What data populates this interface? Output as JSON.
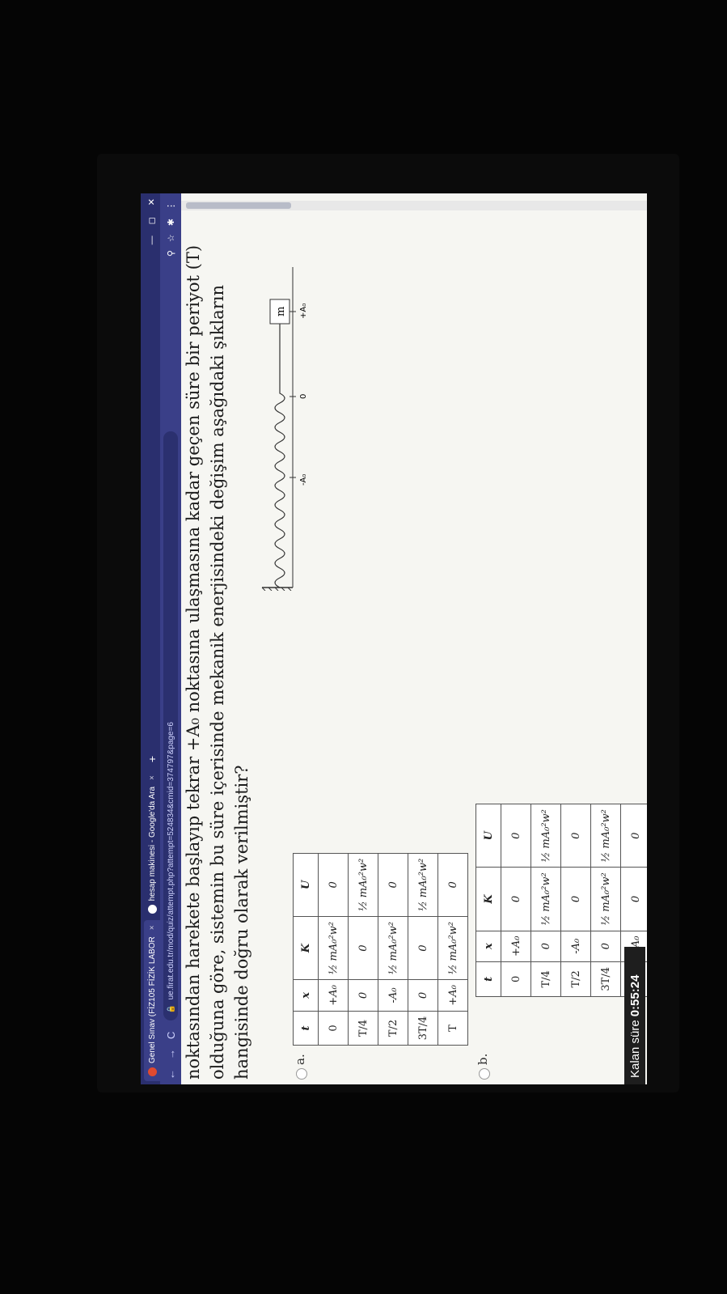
{
  "browser": {
    "tabs": [
      {
        "label": "Genel Sınav (FİZ105 FİZİK LABOR",
        "color": "#e04a2f",
        "active": true
      },
      {
        "label": "hesap makinesi - Google'da Ara",
        "color": "#ffffff",
        "active": false
      }
    ],
    "tab_close": "×",
    "new_tab": "+",
    "window_controls": {
      "minimize": "—",
      "restore": "◻",
      "close": "✕"
    },
    "nav": {
      "back": "←",
      "forward": "→",
      "reload": "C"
    },
    "url": "ue.firat.edu.tr/mod/quiz/attempt.php?attempt=524834&cmid=374797&page=6",
    "addr_icons": {
      "zoom": "⚲",
      "star": "☆",
      "ext1": "✱",
      "menu": "⋮"
    }
  },
  "question": {
    "lines": [
      "noktasından harekete başlayıp tekrar +A₀ noktasına ulaşmasına kadar geçen süre bir periyot (T)",
      "olduğuna göre, sistemin bu süre içerisinde mekanik enerjisindeki değişim aşağıdaki şıkların",
      "hangisinde doğru olarak verilmiştir?"
    ]
  },
  "diagram": {
    "labels": {
      "minus_a": "-A₀",
      "zero": "0",
      "plus_a": "+A₀",
      "mass": "m"
    }
  },
  "headers": [
    "t",
    "x",
    "K",
    "U"
  ],
  "options": [
    {
      "letter": "a.",
      "rows": [
        [
          "0",
          "+A₀",
          "½ mA₀²w²",
          "0"
        ],
        [
          "T/4",
          "0",
          "0",
          "½ mA₀²w²"
        ],
        [
          "T/2",
          "-A₀",
          "½ mA₀²w²",
          "0"
        ],
        [
          "3T/4",
          "0",
          "0",
          "½ mA₀²w²"
        ],
        [
          "T",
          "+A₀",
          "½ mA₀²w²",
          "0"
        ]
      ]
    },
    {
      "letter": "b.",
      "rows": [
        [
          "0",
          "+A₀",
          "0",
          "0"
        ],
        [
          "T/4",
          "0",
          "½ mA₀²w²",
          "½ mA₀²w²"
        ],
        [
          "T/2",
          "-A₀",
          "0",
          "0"
        ],
        [
          "3T/4",
          "0",
          "½ mA₀²w²",
          "½ mA₀²w²"
        ],
        [
          "",
          "+A₀",
          "0",
          "0"
        ]
      ]
    }
  ],
  "timer": {
    "label": "Kalan süre",
    "value": "0:55:24"
  }
}
